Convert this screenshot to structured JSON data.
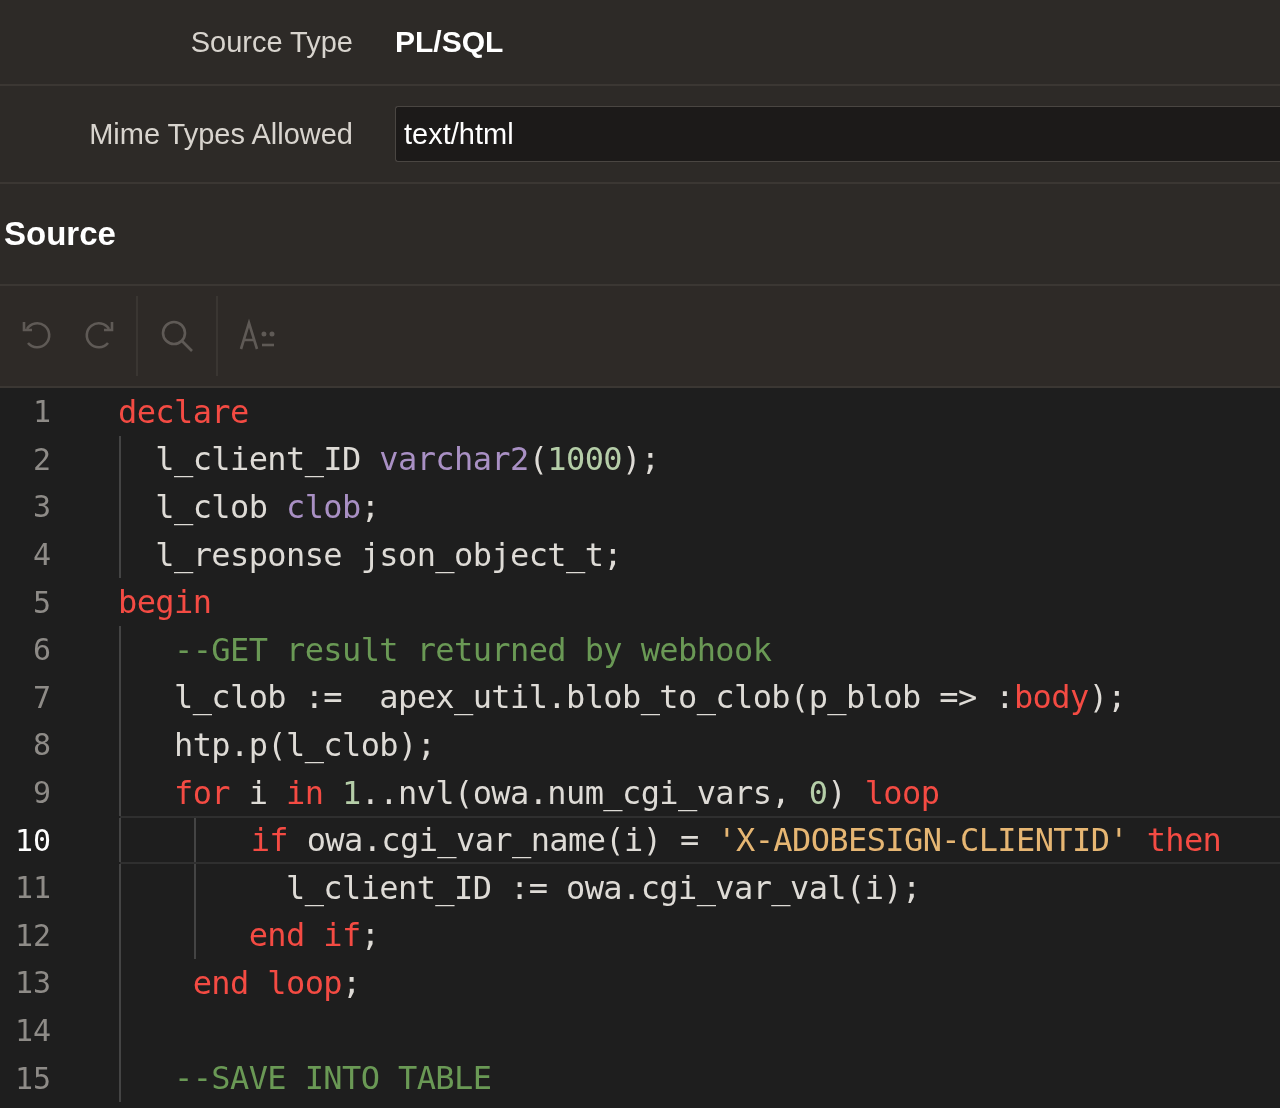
{
  "fields": [
    {
      "label": "Source Type",
      "kind": "display",
      "value": "PL/SQL"
    },
    {
      "label": "Mime Types Allowed",
      "kind": "input",
      "value": "text/html"
    }
  ],
  "section": {
    "title": "Source"
  },
  "code": {
    "lines": [
      {
        "number": "1",
        "current": false,
        "tokens": [
          {
            "kind": "keyword",
            "text": "declare"
          }
        ]
      },
      {
        "number": "2",
        "current": false,
        "tokens": [
          {
            "kind": "plain",
            "text": "  l_client_ID "
          },
          {
            "kind": "type",
            "text": "varchar2"
          },
          {
            "kind": "plain",
            "text": "("
          },
          {
            "kind": "number",
            "text": "1000"
          },
          {
            "kind": "plain",
            "text": ");"
          }
        ]
      },
      {
        "number": "3",
        "current": false,
        "tokens": [
          {
            "kind": "plain",
            "text": "  l_clob "
          },
          {
            "kind": "type",
            "text": "clob"
          },
          {
            "kind": "plain",
            "text": ";"
          }
        ]
      },
      {
        "number": "4",
        "current": false,
        "tokens": [
          {
            "kind": "plain",
            "text": "  l_response json_object_t;"
          }
        ]
      },
      {
        "number": "5",
        "current": false,
        "tokens": [
          {
            "kind": "keyword",
            "text": "begin"
          }
        ]
      },
      {
        "number": "6",
        "current": false,
        "tokens": [
          {
            "kind": "comment",
            "text": "   --GET result returned by webhook"
          }
        ]
      },
      {
        "number": "7",
        "current": false,
        "tokens": [
          {
            "kind": "plain",
            "text": "   l_clob :=  apex_util.blob_to_clob(p_blob => :"
          },
          {
            "kind": "keyword",
            "text": "body"
          },
          {
            "kind": "plain",
            "text": ");"
          }
        ]
      },
      {
        "number": "8",
        "current": false,
        "tokens": [
          {
            "kind": "plain",
            "text": "   htp.p(l_clob);"
          }
        ]
      },
      {
        "number": "9",
        "current": false,
        "tokens": [
          {
            "kind": "keyword",
            "text": "   for"
          },
          {
            "kind": "plain",
            "text": " i "
          },
          {
            "kind": "keyword",
            "text": "in "
          },
          {
            "kind": "number",
            "text": "1"
          },
          {
            "kind": "plain",
            "text": "..nvl(owa.num_cgi_vars, "
          },
          {
            "kind": "number",
            "text": "0"
          },
          {
            "kind": "plain",
            "text": ") "
          },
          {
            "kind": "keyword",
            "text": "loop"
          }
        ]
      },
      {
        "number": "10",
        "current": true,
        "tokens": [
          {
            "kind": "keyword",
            "text": "       if"
          },
          {
            "kind": "plain",
            "text": " owa.cgi_var_name(i) = "
          },
          {
            "kind": "string",
            "text": "'X-ADOBESIGN-CLIENTID' "
          },
          {
            "kind": "keyword",
            "text": "then"
          }
        ]
      },
      {
        "number": "11",
        "current": false,
        "tokens": [
          {
            "kind": "plain",
            "text": "         l_client_ID := owa.cgi_var_val(i);"
          }
        ]
      },
      {
        "number": "12",
        "current": false,
        "tokens": [
          {
            "kind": "keyword",
            "text": "       end if"
          },
          {
            "kind": "plain",
            "text": ";"
          }
        ]
      },
      {
        "number": "13",
        "current": false,
        "tokens": [
          {
            "kind": "keyword",
            "text": "    end loop"
          },
          {
            "kind": "plain",
            "text": ";"
          }
        ]
      },
      {
        "number": "14",
        "current": false
      },
      {
        "number": "15",
        "current": false,
        "tokens": [
          {
            "kind": "comment",
            "text": "   --SAVE INTO TABLE"
          }
        ]
      }
    ]
  }
}
